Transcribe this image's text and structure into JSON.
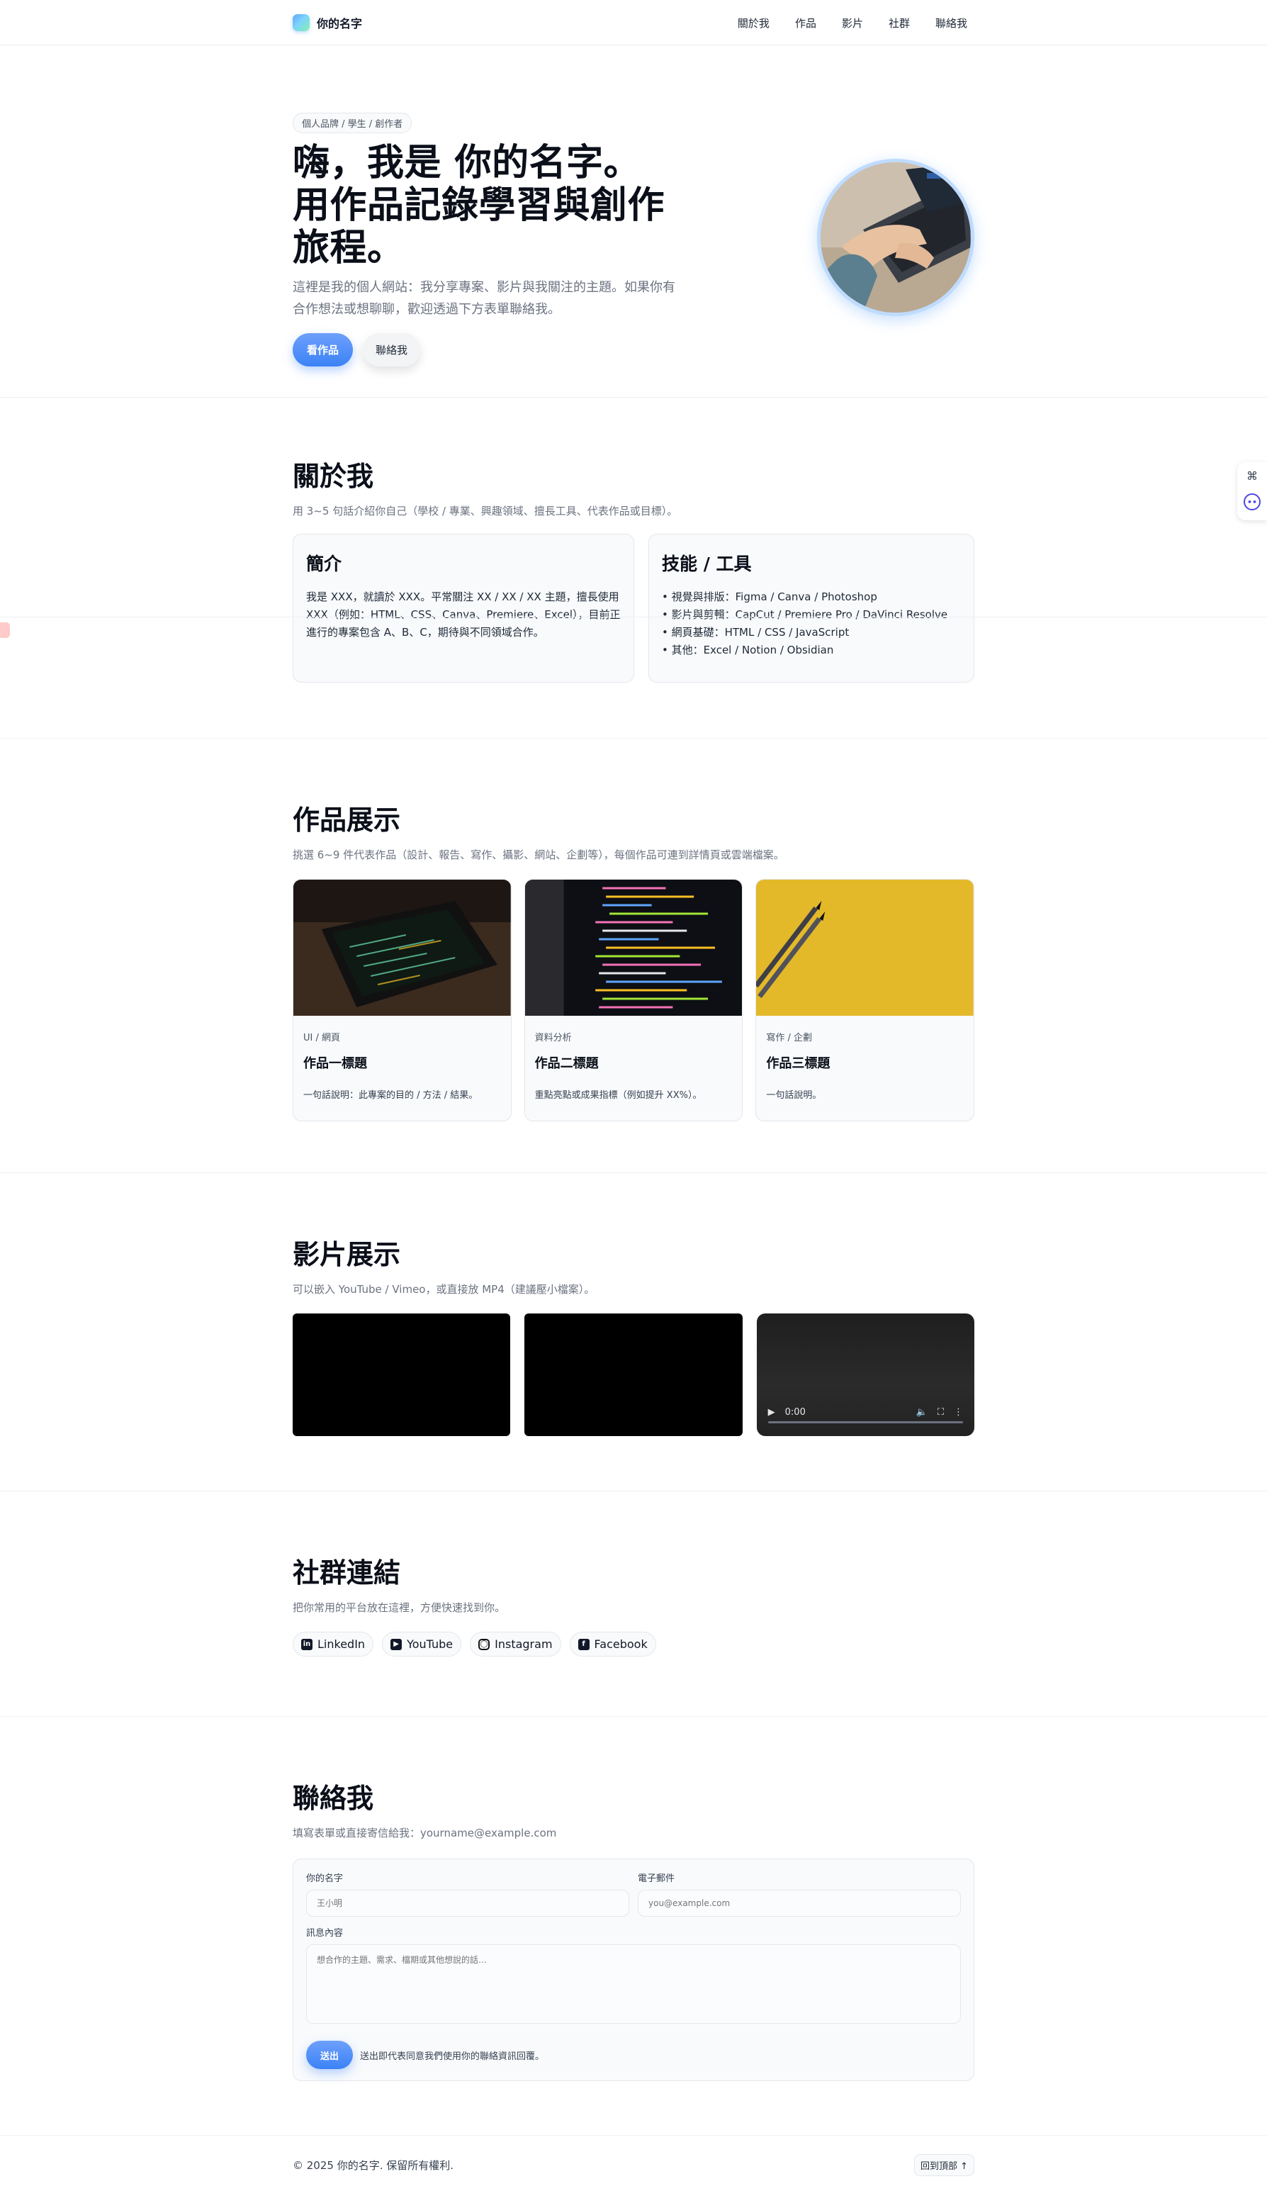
{
  "header": {
    "brand": "你的名字",
    "nav": [
      "關於我",
      "作品",
      "影片",
      "社群",
      "聯絡我"
    ]
  },
  "hero": {
    "tag": "個人品牌 / 學生 / 創作者",
    "title_line1": "嗨，我是 你的名字。",
    "title_line2": "用作品記錄學習與創作",
    "title_line3": "旅程。",
    "desc": "這裡是我的個人網站：我分享專案、影片與我關注的主題。如果你有合作想法或想聊聊，歡迎透過下方表單聯絡我。",
    "btn_primary": "看作品",
    "btn_secondary": "聯絡我"
  },
  "about": {
    "title": "關於我",
    "sub": "用 3~5 句話介紹你自己（學校 / 專業、興趣領域、擅長工具、代表作品或目標）。",
    "intro_title": "簡介",
    "intro_body": "我是 XXX，就讀於 XXX。平常關注 XX / XX / XX 主題，擅長使用 XXX（例如：HTML、CSS、Canva、Premiere、Excel），目前正進行的專案包含 A、B、C，期待與不同領域合作。",
    "skills_title": "技能 / 工具",
    "skills": [
      "• 視覺與排版：Figma / Canva / Photoshop",
      "• 影片與剪輯：CapCut / Premiere Pro / DaVinci Resolve",
      "• 網頁基礎：HTML / CSS / JavaScript",
      "• 其他：Excel / Notion / Obsidian"
    ]
  },
  "works": {
    "title": "作品展示",
    "sub": "挑選 6~9 件代表作品（設計、報告、寫作、攝影、網站、企劃等），每個作品可連到詳情頁或雲端檔案。",
    "items": [
      {
        "category": "UI / 網頁",
        "title": "作品一標題",
        "desc": "一句話說明：此專案的目的 / 方法 / 結果。"
      },
      {
        "category": "資料分析",
        "title": "作品二標題",
        "desc": "重點亮點或成果指標（例如提升 XX%）。"
      },
      {
        "category": "寫作 / 企劃",
        "title": "作品三標題",
        "desc": "一句話說明。"
      }
    ]
  },
  "videos": {
    "title": "影片展示",
    "sub": "可以嵌入 YouTube / Vimeo，或直接放 MP4（建議壓小檔案）。",
    "player_time": "0:00"
  },
  "social": {
    "title": "社群連結",
    "sub": "把你常用的平台放在這裡，方便快速找到你。",
    "links": [
      "LinkedIn",
      "YouTube",
      "Instagram",
      "Facebook"
    ]
  },
  "contact": {
    "title": "聯絡我",
    "sub": "填寫表單或直接寄信給我：yourname@example.com",
    "name_label": "你的名字",
    "name_placeholder": "王小明",
    "email_label": "電子郵件",
    "email_placeholder": "you@example.com",
    "msg_label": "訊息內容",
    "msg_placeholder": "想合作的主題、需求、檔期或其他想說的話…",
    "send": "送出",
    "note": "送出即代表同意我們使用你的聯絡資訊回覆。"
  },
  "footer": {
    "copy": "© 2025 你的名字. 保留所有權利.",
    "top": "回到頂部 ↑"
  },
  "colors": {
    "accent": "#3b82f6",
    "avatar_ring": "#bfdbfe",
    "work3_bg": "#e3b92a"
  }
}
